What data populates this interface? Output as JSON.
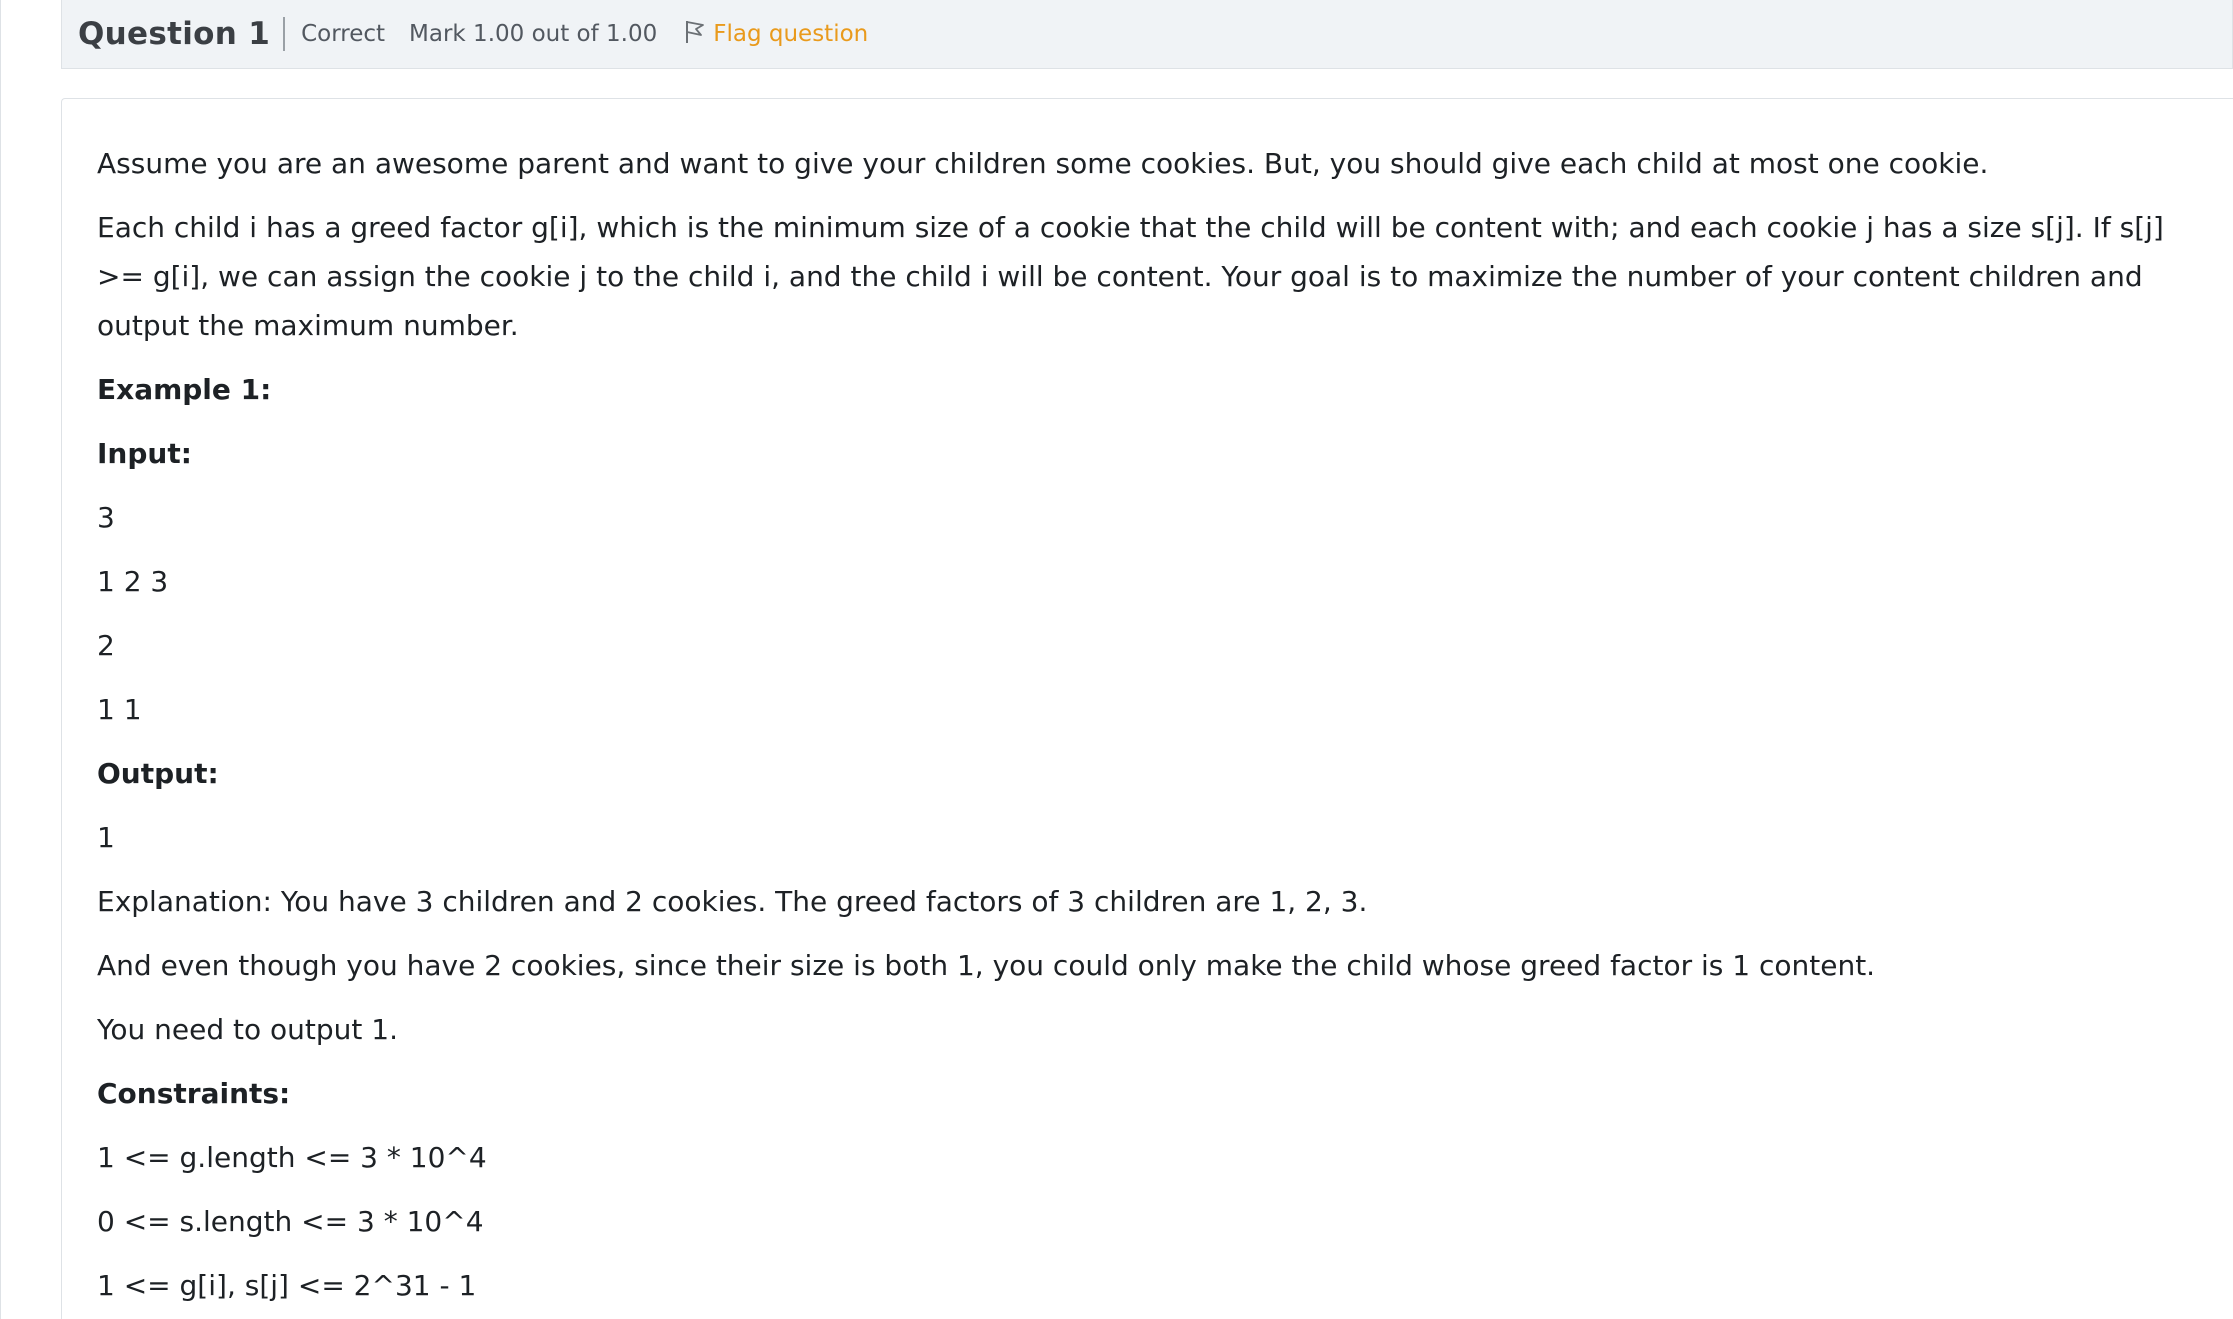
{
  "info": {
    "question_label": "Question 1",
    "state": "Correct",
    "grade": "Mark 1.00 out of 1.00",
    "flag_label": "Flag question",
    "flag_icon": "flag-icon"
  },
  "colors": {
    "flag_accent": "#e99a1c",
    "info_bar_bg": "#f0f3f6"
  },
  "question": {
    "intro": "Assume you are an awesome parent and want to give your children some cookies. But, you should give each child at most one cookie.",
    "description": "Each child i has a greed factor g[i], which is the minimum size of a cookie that the child will be content with; and each cookie j has a size s[j]. If s[j] >= g[i], we can assign the cookie j to the child i, and the child i will be content. Your goal is to maximize the number of your content children and output the maximum number.",
    "example_heading": "Example 1:",
    "input_heading": "Input:",
    "input_lines": [
      "3",
      "1 2 3",
      "2",
      "1 1"
    ],
    "output_heading": "Output:",
    "output_value": "1",
    "explanation_1": "Explanation: You have 3 children and 2 cookies. The greed factors of 3 children are 1, 2, 3.",
    "explanation_2": "And even though you have 2 cookies, since their size is both 1, you could only make the child whose greed factor is 1 content.",
    "explanation_3": "You need to output 1.",
    "constraints_heading": "Constraints:",
    "constraints": [
      "1 <= g.length <= 3 * 10^4",
      "0 <= s.length <= 3 * 10^4",
      "1 <= g[i], s[j] <= 2^31 - 1"
    ]
  }
}
